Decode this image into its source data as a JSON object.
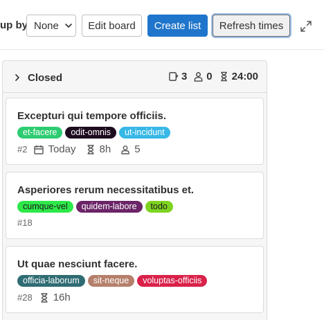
{
  "toolbar": {
    "group_by_label": "up by",
    "group_by_value": "None",
    "edit_board": "Edit board",
    "create_list": "Create list",
    "refresh_times": "Refresh times"
  },
  "list": {
    "title": "Closed",
    "issue_count": "3",
    "assignee_count": "0",
    "time": "24:00"
  },
  "cards": [
    {
      "title": "Excepturi qui tempore officiis.",
      "labels": [
        {
          "text": "et-facere",
          "bg": "#2ecc71",
          "fg": "#ffffff"
        },
        {
          "text": "odit-omnis",
          "bg": "#1e0c1f",
          "fg": "#ffffff"
        },
        {
          "text": "ut-incidunt",
          "bg": "#37b8e6",
          "fg": "#ffffff"
        }
      ],
      "number": "#2",
      "due": "Today",
      "estimate": "8h",
      "assignees": "5"
    },
    {
      "title": "Asperiores rerum necessitatibus et.",
      "labels": [
        {
          "text": "cumque-vel",
          "bg": "#2ee84a",
          "fg": "#1a1a1a"
        },
        {
          "text": "quidem-labore",
          "bg": "#6b2467",
          "fg": "#ffffff"
        },
        {
          "text": "todo",
          "bg": "#7ed321",
          "fg": "#1a1a1a"
        }
      ],
      "number": "#18"
    },
    {
      "title": "Ut quae nesciunt facere.",
      "labels": [
        {
          "text": "officia-laborum",
          "bg": "#2f6c73",
          "fg": "#ffffff"
        },
        {
          "text": "sit-neque",
          "bg": "#b5806b",
          "fg": "#ffffff"
        },
        {
          "text": "voluptas-officiis",
          "bg": "#d9214a",
          "fg": "#ffffff"
        }
      ],
      "number": "#28",
      "estimate": "16h"
    }
  ]
}
